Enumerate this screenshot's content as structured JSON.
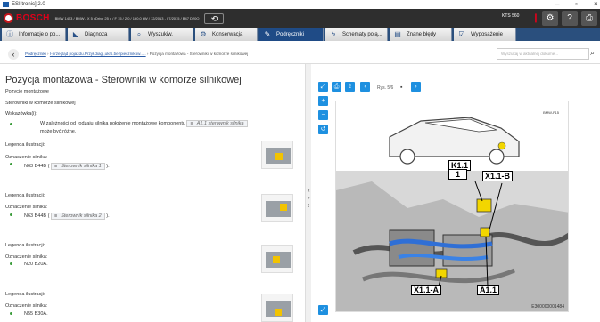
{
  "window": {
    "title": "ESI[tronic] 2.0"
  },
  "topbar": {
    "brand": "BOSCH",
    "vehicle": "BMW 1453 / BMW / X 5 xDrive 25 d / F 15 / 2.0 / 160.0 kW / 12/2013 - 07/2015 / B47 D20O",
    "device": "KTS 560"
  },
  "tabs": [
    {
      "label": "Informacje o po...",
      "icon": "info-icon"
    },
    {
      "label": "Diagnoza",
      "icon": "car-icon"
    },
    {
      "label": "Wyszukiw.",
      "icon": "search-icon"
    },
    {
      "label": "Konserwacja",
      "icon": "gears-icon"
    },
    {
      "label": "Podręczniki",
      "icon": "wrench-icon"
    },
    {
      "label": "Schematy połą...",
      "icon": "lightning-icon"
    },
    {
      "label": "Znane błędy",
      "icon": "book-icon"
    },
    {
      "label": "Wyposażenie",
      "icon": "checklist-icon"
    }
  ],
  "breadcrumb": {
    "link1": "Podręczniki",
    "sep1": " › ",
    "link2": "I-przegląd pojazdu.Przył.diag.,ukrs.bezpieczników.....",
    "sep2": " › ",
    "current": "Pozycja montażowa - Sterowniki w komorze silnikowej"
  },
  "search": {
    "placeholder": "Wyszukaj w aktualnej dokume..."
  },
  "content": {
    "title": "Pozycja montażowa - Sterowniki w komorze silnikowej",
    "sub1": "Pozycje montażowe",
    "sub2": "Sterowniki w komorze silnikowej",
    "note_label": "Wskazówka(i):",
    "note_text_a": "W zależności od rodzaju silnika położenie montażowe komponentu",
    "note_comp": "A1.1 sterownik silnika",
    "note_text_b": "może być różne.",
    "groups": [
      {
        "legend": "Legenda ilustracji:",
        "engine_label": "Oznaczenie silnika:",
        "engine": "N63 B44B (",
        "comp": "Sterownik silnika 1",
        "suffix": ")."
      },
      {
        "legend": "Legenda ilustracji:",
        "engine_label": "Oznaczenie silnika:",
        "engine": "N63 B44B (",
        "comp": "Sterownik silnika 2",
        "suffix": ")."
      },
      {
        "legend": "Legenda ilustracji:",
        "engine_label": "Oznaczenie silnika:",
        "engine": "N20 B20A.",
        "comp": "",
        "suffix": ""
      },
      {
        "legend": "Legenda ilustracji:",
        "engine_label": "Oznaczenie silnika:",
        "engine": "N55 B30A.",
        "comp": "",
        "suffix": ""
      }
    ]
  },
  "viewer": {
    "figure": "Rys. 5/6",
    "labels": {
      "k11": "K1.1",
      "one": "1",
      "x11b": "X1.1-B",
      "x11a": "X1.1-A",
      "a11": "A1.1"
    },
    "image_id": "E300000001484",
    "ref": "BMW-F15"
  }
}
